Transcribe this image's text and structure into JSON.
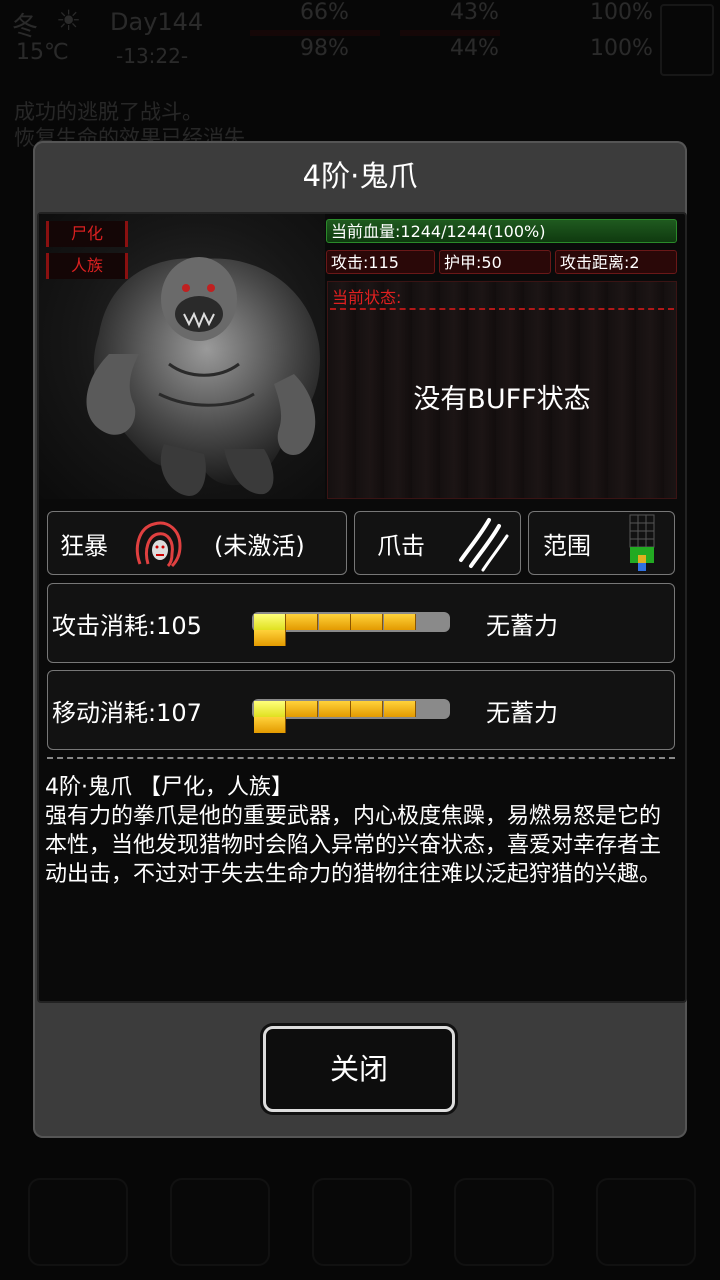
{
  "hud": {
    "season": "冬",
    "day": "Day144",
    "temperature": "15℃",
    "time": "-13:22-",
    "stats": [
      "66%",
      "43%",
      "100%",
      "98%",
      "44%",
      "100%"
    ]
  },
  "background_log": [
    "成功的逃脱了战斗。",
    "恢复生命的效果已经消失"
  ],
  "modal": {
    "title": "4阶·鬼爪",
    "tags": [
      "尸化",
      "人族"
    ],
    "hp": "当前血量:1244/1244(100%)",
    "attack": "攻击:115",
    "armor": "护甲:50",
    "attack_range": "攻击距离:2",
    "state_label": "当前状态:",
    "state_empty": "没有BUFF状态",
    "skills": {
      "rage_label": "狂暴",
      "rage_status": "(未激活)",
      "claw_label": "爪击",
      "range_label": "范围"
    },
    "attack_cost": {
      "label": "攻击消耗:105",
      "status": "无蓄力",
      "level": 0.1
    },
    "move_cost": {
      "label": "移动消耗:107",
      "status": "无蓄力",
      "level": 0.1
    },
    "description_title": "4阶·鬼爪 【尸化，人族】",
    "description": "强有力的拳爪是他的重要武器，内心极度焦躁，易燃易怒是它的本性，当他发现猎物时会陷入异常的兴奋状态，喜爱对幸存者主动出击，不过对于失去生命力的猎物往往难以泛起狩猎的兴趣。",
    "close_label": "关闭"
  },
  "colors": {
    "accent_red": "#e02020",
    "hp_green": "#1f5a1f",
    "bar_yellow": "#ffd23a"
  }
}
